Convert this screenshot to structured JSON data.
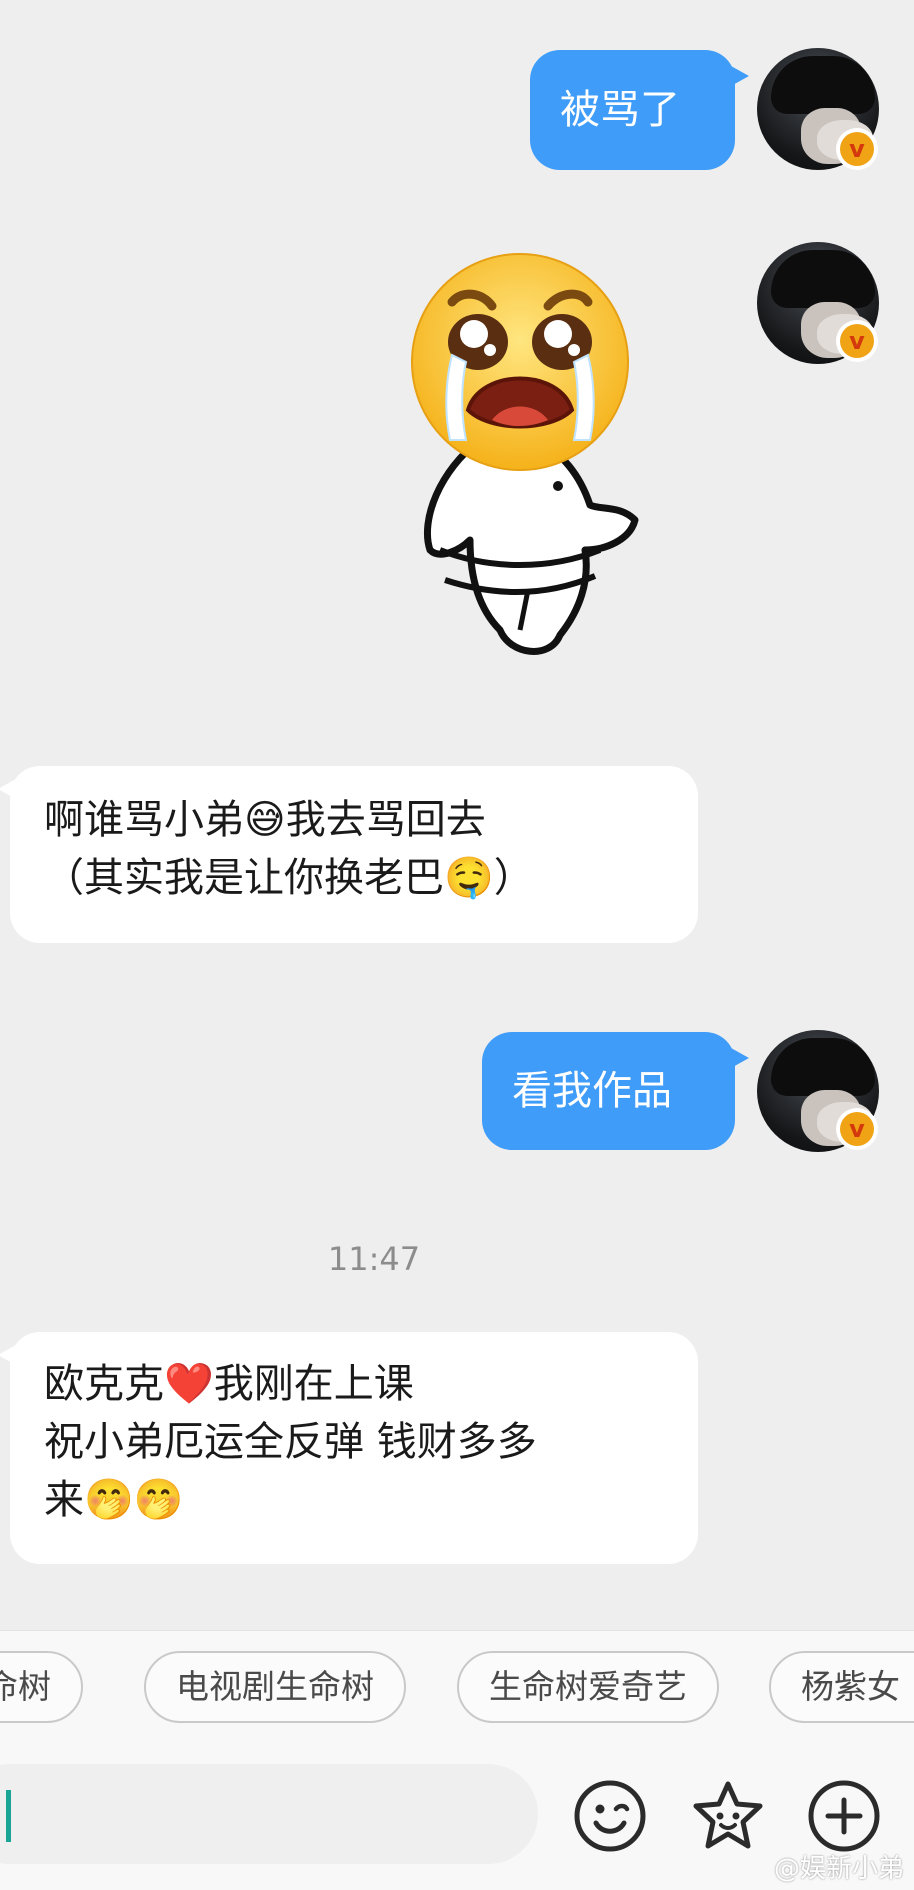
{
  "messages": [
    {
      "from": "me",
      "text": "被骂了"
    },
    {
      "from": "me",
      "type": "sticker",
      "sticker": "crying-angry-face-sticker"
    },
    {
      "from": "them",
      "line1": "啊谁骂小弟😅我去骂回去",
      "line2": "（其实我是让你换老巴🤤）"
    },
    {
      "from": "me",
      "text": "看我作品"
    },
    {
      "from": "them",
      "line1": "欧克克❤️我刚在上课",
      "line2": "祝小弟厄运全反弹 钱财多多",
      "line3": "来🤭🤭"
    }
  ],
  "timestamp": "11:47",
  "suggestions": [
    "生命树",
    "电视剧生命树",
    "生命树爱奇艺",
    "杨紫女"
  ],
  "input": {
    "value": ""
  },
  "toolbar": {
    "icons": [
      "emoji-icon",
      "sticker-icon",
      "plus-icon"
    ]
  },
  "watermark": "@娱新小弟",
  "badge": {
    "symbol": "v"
  },
  "colors": {
    "outgoing": "#3f9cf8",
    "incoming": "#ffffff",
    "background": "#eeeeee",
    "caret": "#18a595",
    "badge": "#f0a315"
  }
}
